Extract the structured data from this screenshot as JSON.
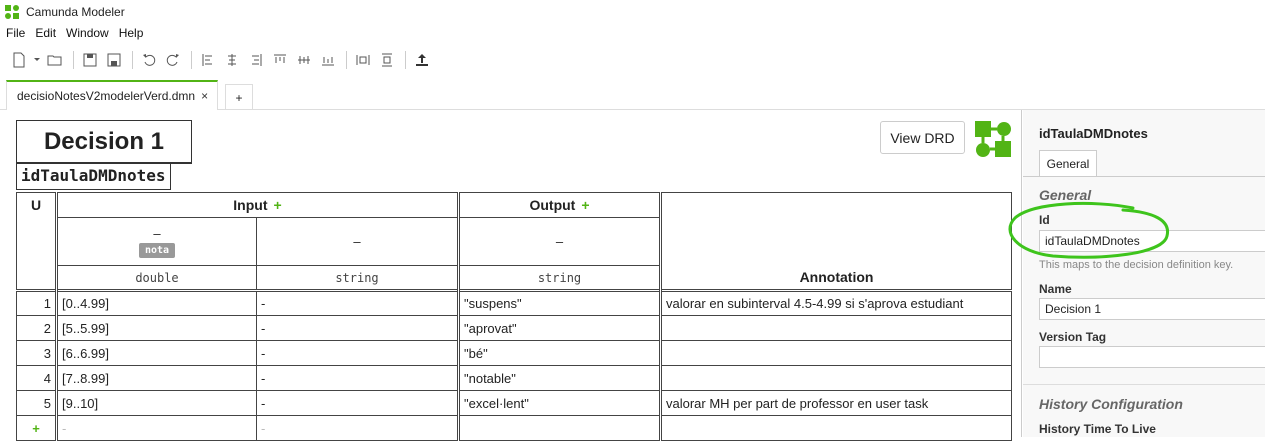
{
  "window": {
    "title": "Camunda Modeler"
  },
  "menu": [
    "File",
    "Edit",
    "Window",
    "Help"
  ],
  "tabs": {
    "active_label": "decisioNotesV2modelerVerd.dmn",
    "close": "×",
    "add": "+"
  },
  "decision": {
    "name": "Decision 1",
    "id": "idTaulaDMDnotes",
    "view_drd": "View DRD"
  },
  "table": {
    "hit_policy": "U",
    "input_header": "Input",
    "output_header": "Output",
    "add_symbol": "+",
    "annotation_header": "Annotation",
    "input_cols": [
      {
        "label": "–",
        "badge": "nota",
        "type": "double"
      },
      {
        "label": "–",
        "type": "string"
      }
    ],
    "output_col": {
      "label": "–",
      "type": "string"
    },
    "rows": [
      {
        "idx": "1",
        "in1": "[0..4.99]",
        "in2": "-",
        "out": "\"suspens\"",
        "ann": "valorar en subinterval 4.5-4.99 si s'aprova estudiant"
      },
      {
        "idx": "2",
        "in1": "[5..5.99]",
        "in2": "-",
        "out": "\"aprovat\"",
        "ann": ""
      },
      {
        "idx": "3",
        "in1": "[6..6.99]",
        "in2": "-",
        "out": "\"bé\"",
        "ann": ""
      },
      {
        "idx": "4",
        "in1": "[7..8.99]",
        "in2": "-",
        "out": "\"notable\"",
        "ann": ""
      },
      {
        "idx": "5",
        "in1": "[9..10]",
        "in2": "-",
        "out": "\"excel·lent\"",
        "ann": "valorar MH per part de professor en user task"
      }
    ],
    "new_row": {
      "idx": "+",
      "in1": "-",
      "in2": "-"
    }
  },
  "properties": {
    "title": "idTaulaDMDnotes",
    "tab": "General",
    "section_general": "General",
    "id_label": "Id",
    "id_value": "idTaulaDMDnotes",
    "id_hint": "This maps to the decision definition key.",
    "name_label": "Name",
    "name_value": "Decision 1",
    "version_label": "Version Tag",
    "version_value": "",
    "section_history": "History Configuration",
    "history_ttl_label": "History Time To Live"
  },
  "colors": {
    "accent": "#52b415",
    "annotation_circle": "#3ec41c"
  }
}
